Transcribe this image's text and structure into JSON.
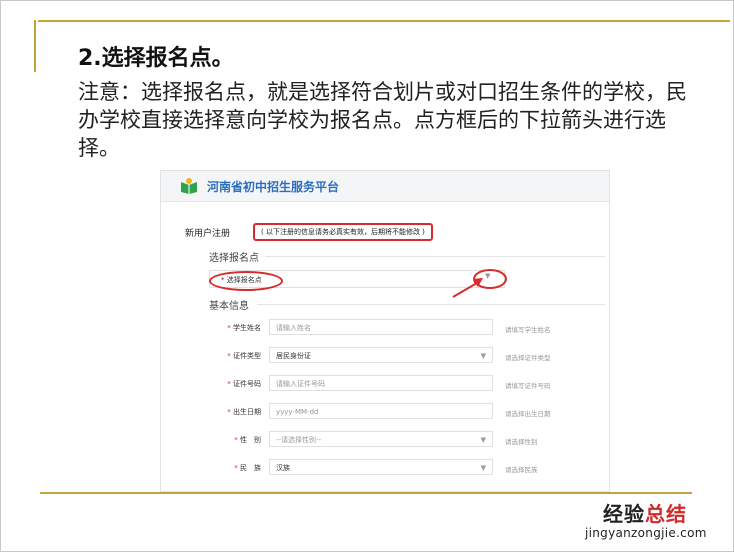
{
  "slide": {
    "heading": "2.选择报名点。",
    "description": "注意：选择报名点，就是选择符合划片或对口招生条件的学校，民办学校直接选择意向学校为报名点。点方框后的下拉箭头进行选择。"
  },
  "screenshot": {
    "site_title": "河南省初中招生服务平台",
    "register_label": "新用户注册",
    "register_notice": "( 以下注册的信息请务必真实有效，后期将不能修改 )",
    "section_pick": "选择报名点",
    "pick_placeholder": "* 选择报名点",
    "section_basic": "基本信息",
    "rows": [
      {
        "label": "学生姓名",
        "value": "请输入姓名",
        "hint": "请填写学生姓名",
        "filled": false,
        "dropdown": false
      },
      {
        "label": "证件类型",
        "value": "居民身份证",
        "hint": "请选择证件类型",
        "filled": true,
        "dropdown": true
      },
      {
        "label": "证件号码",
        "value": "请输入证件号码",
        "hint": "请填写证件号码",
        "filled": false,
        "dropdown": false
      },
      {
        "label": "出生日期",
        "value": "yyyy-MM-dd",
        "hint": "请选择出生日期",
        "filled": false,
        "dropdown": false
      },
      {
        "label": "性　别",
        "value": "--请选择性别--",
        "hint": "请选择性别",
        "filled": false,
        "dropdown": true
      },
      {
        "label": "民　族",
        "value": "汉族",
        "hint": "请选择民族",
        "filled": true,
        "dropdown": true
      }
    ],
    "required_mark": "*"
  },
  "watermark": {
    "cn_part1": "经验",
    "cn_part2": "总结",
    "en": "jingyanzongjie.com"
  },
  "colors": {
    "gold": "#c5a33a",
    "highlight_red": "#d92b2b",
    "brand_blue": "#2b6fc2"
  }
}
